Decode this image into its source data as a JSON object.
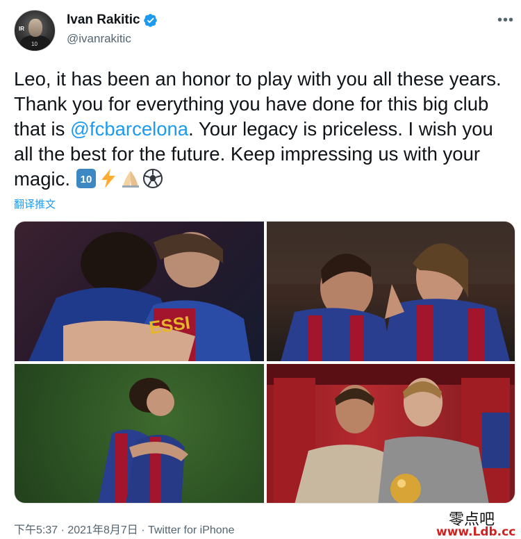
{
  "author": {
    "display_name": "Ivan Rakitic",
    "handle": "@ivanrakitic",
    "verified": true,
    "avatar_icon": "avatar-photo",
    "accent_color": "#1d9bf0"
  },
  "menu": {
    "more_label": "•••"
  },
  "tweet": {
    "text_part1": "Leo, it has been an honor to play with you all these years. Thank you for everything you have done for this big club that is ",
    "mention": "@fcbarcelona",
    "text_part2": ". Your legacy is priceless. I wish you all the best for the future. Keep impressing us with your magic. ",
    "emojis": [
      "keycap-ten-icon",
      "high-voltage-icon",
      "folded-hands-icon",
      "soccer-ball-icon"
    ],
    "translate_label": "翻译推文"
  },
  "media": {
    "photos": [
      {
        "name": "photo-messi-rakitic-hug"
      },
      {
        "name": "photo-messi-rakitic-match"
      },
      {
        "name": "photo-messi-rakitic-pitch-hug"
      },
      {
        "name": "photo-messi-rakitic-locker-room"
      }
    ]
  },
  "meta": {
    "timestamp": "下午5:37 · 2021年8月7日 · Twitter for iPhone"
  },
  "watermark": {
    "chinese": "零点吧",
    "url": "www.Ldb.cc"
  }
}
